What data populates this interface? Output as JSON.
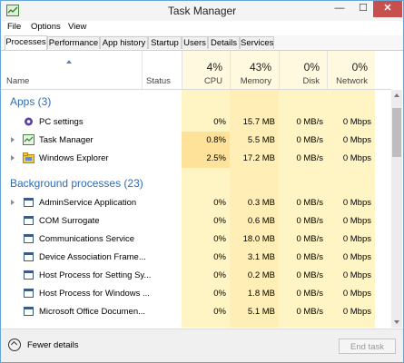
{
  "title": "Task Manager",
  "window_controls": {
    "minimize": "—",
    "maximize": "☐",
    "close": "✕"
  },
  "menu": [
    {
      "label": "File"
    },
    {
      "label": "Options"
    },
    {
      "label": "View"
    }
  ],
  "tabs": [
    {
      "label": "Processes",
      "active": true
    },
    {
      "label": "Performance"
    },
    {
      "label": "App history"
    },
    {
      "label": "Startup"
    },
    {
      "label": "Users"
    },
    {
      "label": "Details"
    },
    {
      "label": "Services"
    }
  ],
  "columns": {
    "name": "Name",
    "status": "Status",
    "cpu": {
      "percent": "4%",
      "label": "CPU"
    },
    "memory": {
      "percent": "43%",
      "label": "Memory"
    },
    "disk": {
      "percent": "0%",
      "label": "Disk"
    },
    "network": {
      "percent": "0%",
      "label": "Network"
    }
  },
  "groups": {
    "apps": "Apps (3)",
    "background": "Background processes (23)"
  },
  "apps": [
    {
      "name": "PC settings",
      "icon": "pc-settings-icon",
      "cpu": "0%",
      "memory": "15.7 MB",
      "disk": "0 MB/s",
      "network": "0 Mbps"
    },
    {
      "name": "Task Manager",
      "icon": "task-manager-icon",
      "cpu": "0.8%",
      "memory": "5.5 MB",
      "disk": "0 MB/s",
      "network": "0 Mbps"
    },
    {
      "name": "Windows Explorer",
      "icon": "windows-explorer-icon",
      "cpu": "2.5%",
      "memory": "17.2 MB",
      "disk": "0 MB/s",
      "network": "0 Mbps"
    }
  ],
  "background": [
    {
      "name": "AdminService Application",
      "cpu": "0%",
      "memory": "0.3 MB",
      "disk": "0 MB/s",
      "network": "0 Mbps"
    },
    {
      "name": "COM Surrogate",
      "cpu": "0%",
      "memory": "0.6 MB",
      "disk": "0 MB/s",
      "network": "0 Mbps"
    },
    {
      "name": "Communications Service",
      "cpu": "0%",
      "memory": "18.0 MB",
      "disk": "0 MB/s",
      "network": "0 Mbps"
    },
    {
      "name": "Device Association Frame...",
      "cpu": "0%",
      "memory": "3.1 MB",
      "disk": "0 MB/s",
      "network": "0 Mbps"
    },
    {
      "name": "Host Process for Setting Sy...",
      "cpu": "0%",
      "memory": "0.2 MB",
      "disk": "0 MB/s",
      "network": "0 Mbps"
    },
    {
      "name": "Host Process for Windows ...",
      "cpu": "0%",
      "memory": "1.8 MB",
      "disk": "0 MB/s",
      "network": "0 Mbps"
    },
    {
      "name": "Microsoft Office Documen...",
      "cpu": "0%",
      "memory": "5.1 MB",
      "disk": "0 MB/s",
      "network": "0 Mbps"
    }
  ],
  "footer": {
    "fewer_details": "Fewer details",
    "end_task": "End task"
  },
  "colors": {
    "heat_light": "#fff4c4",
    "heat_mid": "#ffe9a3",
    "group_blue": "#2e6db5",
    "close_red": "#c7504f"
  }
}
